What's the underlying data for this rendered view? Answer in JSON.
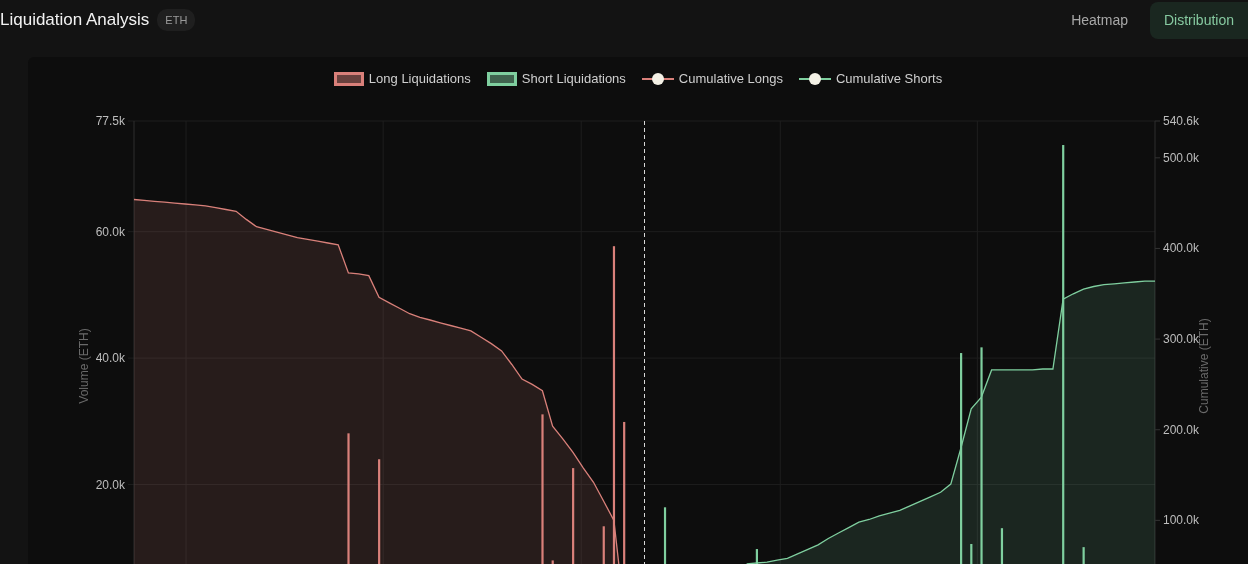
{
  "header": {
    "title": "Liquidation Analysis",
    "badge": "ETH"
  },
  "view_tabs": [
    {
      "label": "Heatmap",
      "selected": false
    },
    {
      "label": "Distribution",
      "selected": true
    }
  ],
  "chart": {
    "legend": [
      {
        "label": "Long Liquidations",
        "kind": "box",
        "color": "#d9807a"
      },
      {
        "label": "Short Liquidations",
        "kind": "box",
        "color": "#7fcf9f"
      },
      {
        "label": "Cumulative Longs",
        "kind": "line",
        "color": "#d9807a"
      },
      {
        "label": "Cumulative Shorts",
        "kind": "line",
        "color": "#7fcf9f"
      }
    ],
    "y_axis_title": "Volume (ETH)",
    "y_axis_labels": [
      "77.5k",
      "60.0k",
      "40.0k",
      "20.0k"
    ],
    "y2_axis_title": "Cumulative (ETH)",
    "y2_axis_labels": [
      "540.6k",
      "500.0k",
      "400.0k",
      "300.0k",
      "200.0k",
      "100.0k"
    ]
  }
}
